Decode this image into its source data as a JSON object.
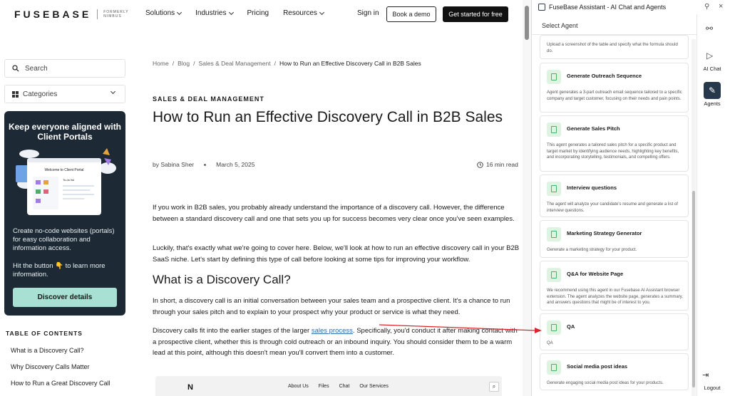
{
  "header": {
    "logo": "FUSEBASE",
    "logo_former": "FORMERLY NIMBUS",
    "menu": [
      "Solutions",
      "Industries",
      "Pricing",
      "Resources"
    ],
    "signin": "Sign in",
    "demo": "Book a demo",
    "start": "Get started for free"
  },
  "sidebar": {
    "search_placeholder": "Search",
    "categories": "Categories",
    "promo": {
      "title": "Keep everyone aligned with Client Portals",
      "mock_title": "Welcome to Client Portal",
      "mock_todo": "To-do list",
      "text1": "Create no-code websites (portals) for easy collaboration and information access.",
      "text2": "Hit the button 👇 to learn more information.",
      "button": "Discover details"
    },
    "toc_heading": "TABLE OF CONTENTS",
    "toc": [
      "What is a Discovery Call?",
      "Why Discovery Calls Matter",
      "How to Run a Great Discovery Call"
    ]
  },
  "article": {
    "breadcrumb": [
      "Home",
      "Blog",
      "Sales & Deal Management",
      "How to Run an Effective Discovery Call in B2B Sales"
    ],
    "category": "SALES & DEAL MANAGEMENT",
    "title": "How to Run an Effective Discovery Call in B2B Sales",
    "author": "by Sabina Sher",
    "date": "March 5, 2025",
    "read_time": "16 min read",
    "p1": "If you work in B2B sales, you probably already understand the importance of a discovery call. However, the difference between a standard discovery call and one that sets you up for success becomes very clear once you've seen examples.",
    "p2": "Luckily, that's exactly what we're going to cover here. Below, we'll look at how to run an effective discovery call in your B2B SaaS niche. Let's start by defining this type of call before looking at some tips for improving your workflow.",
    "h2": "What is a Discovery Call?",
    "p3": "In short, a discovery call is an initial conversation between your sales team and a prospective client. It's a chance to run through your sales pitch and to explain to your prospect why your product or service is what they need.",
    "p4_before": "Discovery calls fit into the earlier stages of the larger ",
    "p4_link": "sales process",
    "p4_after": ". Specifically, you'd conduct it after making contact with a prospective client, whether this is through cold outreach or an inbound inquiry. You should consider them to be a warm lead at this point, although this doesn't mean you'll convert them into a customer.",
    "shot_nav": [
      "About Us",
      "Files",
      "Chat",
      "Our Services"
    ]
  },
  "assistant": {
    "title": "FuseBase Assistant - AI Chat and Agents",
    "select_agent": "Select Agent",
    "partial_desc": "Upload a screenshot of the table and specify what the formula should do.",
    "agents": [
      {
        "name": "Generate Outreach Sequence",
        "desc": "Agent generates a 3-part outreach email sequence tailored to a specific company and target customer, focusing on their needs and pain points."
      },
      {
        "name": "Generate Sales Pitch",
        "desc": "This agent generates a tailored sales pitch for a specific product and target market by identifying audience needs, highlighting key benefits, and incorporating storytelling, testimonials, and compelling offers."
      },
      {
        "name": "Interview questions",
        "desc": "The agent will analyze your candidate's resume and generate a list of interview questions."
      },
      {
        "name": "Marketing Strategy Generator",
        "desc": "Generate a marketing strategy for your product."
      },
      {
        "name": "Q&A for Website Page",
        "desc": "We recommend using this agent in our Fusebase AI Assistant browser extension. The agent analyzes the website page, generates a summary, and answers questions that might be of interest to you."
      },
      {
        "name": "QA",
        "desc": "QA"
      },
      {
        "name": "Social media post ideas",
        "desc": "Generate engaging social media post ideas for your products."
      }
    ],
    "rail": {
      "chat": "AI Chat",
      "agents": "Agents",
      "logout": "Logout"
    }
  },
  "colors": {
    "promo_bg": "#1d2a35",
    "promo_btn": "#a8e0d3",
    "agent_icon": "#4caf68",
    "arrow": "#d9262c",
    "link": "#2b6cb0"
  }
}
